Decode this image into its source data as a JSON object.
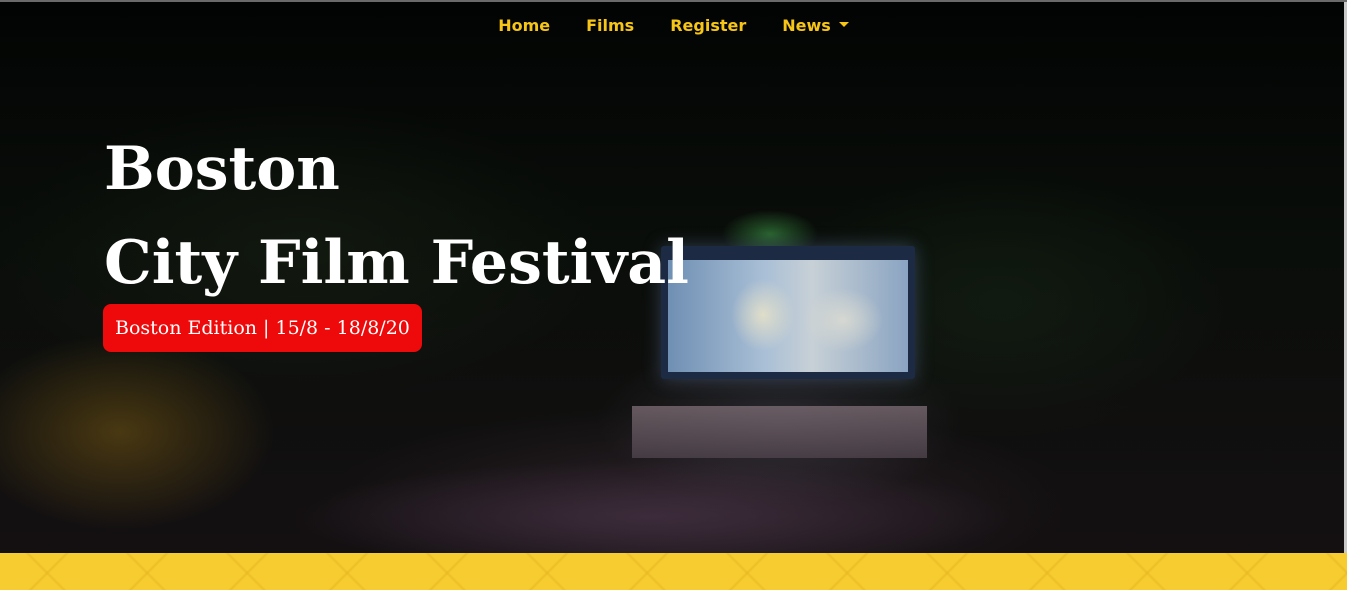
{
  "nav": {
    "items": [
      {
        "label": "Home"
      },
      {
        "label": "Films"
      },
      {
        "label": "Register"
      },
      {
        "label": "News",
        "has_dropdown": true
      }
    ]
  },
  "hero": {
    "title_line1": "Boston",
    "title_line2": "City Film Festival",
    "edition_badge": "Boston Edition | 15/8 - 18/8/20"
  },
  "colors": {
    "nav_text": "#f6c518",
    "badge_bg": "#ee0a0a",
    "band_bg": "#f6cc31",
    "hero_bg": "#000000"
  }
}
